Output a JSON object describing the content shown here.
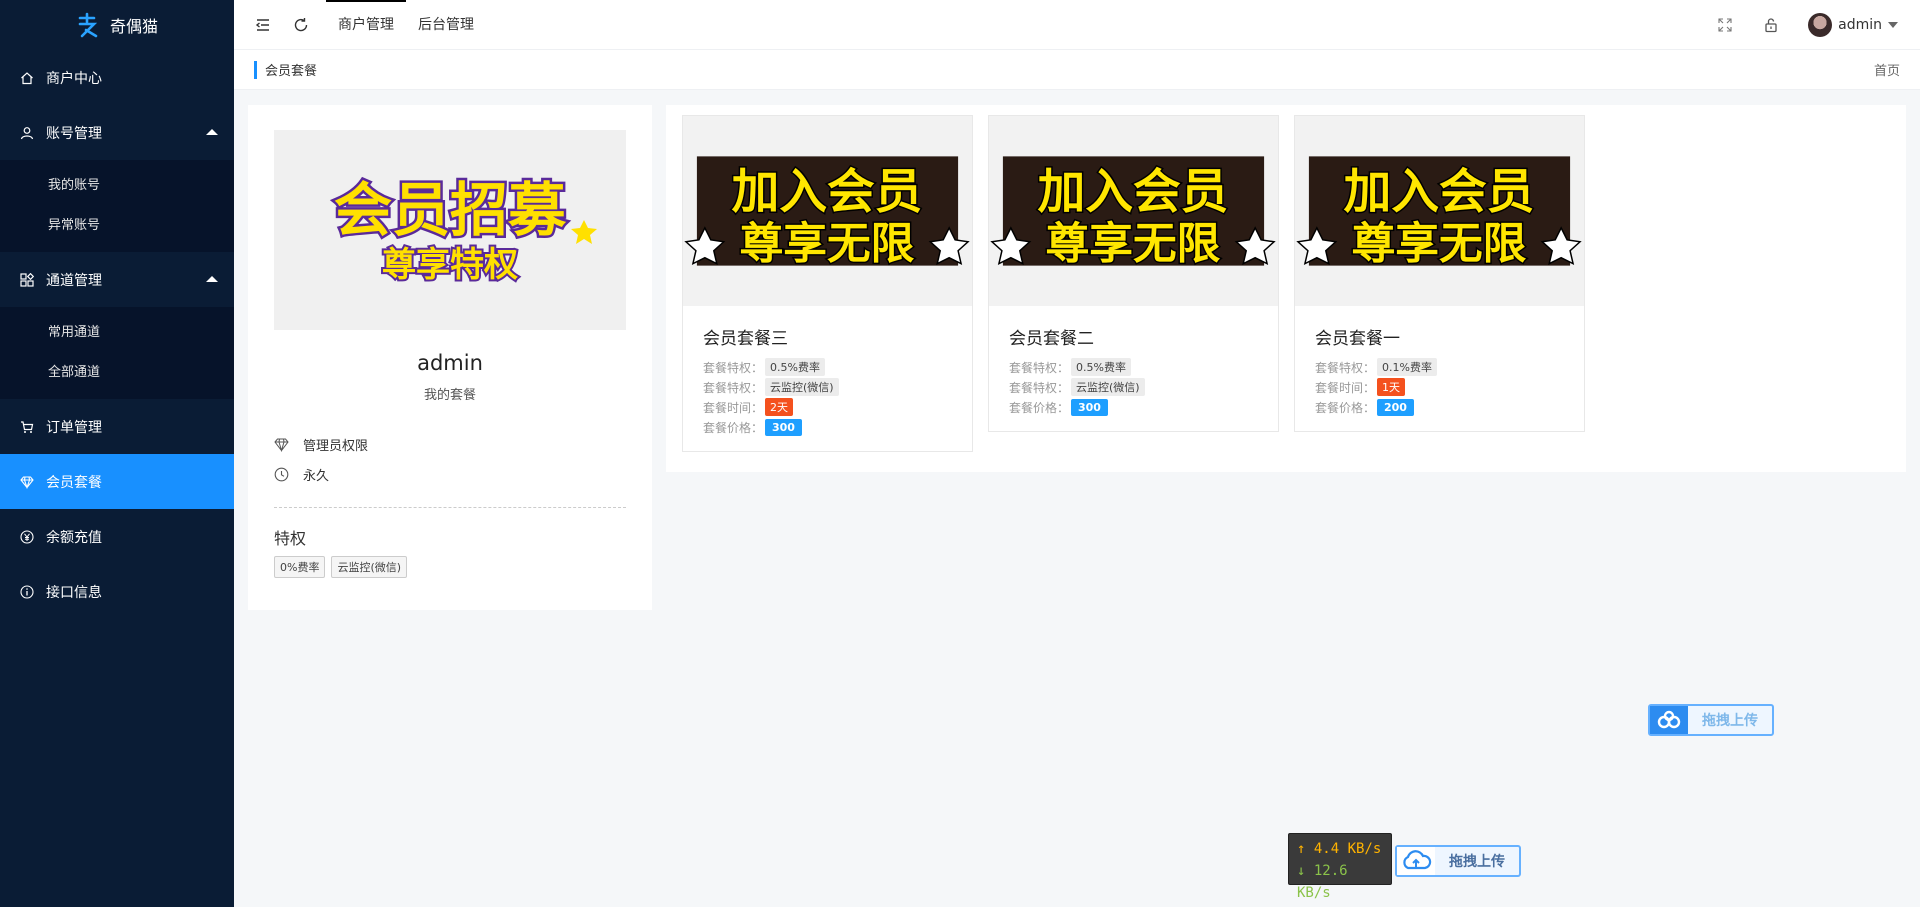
{
  "app": {
    "logo_text": "奇偶猫"
  },
  "sidebar": {
    "items": [
      {
        "label": "商户中心",
        "icon": "home-icon"
      },
      {
        "label": "账号管理",
        "icon": "user-icon",
        "children": [
          "我的账号",
          "异常账号"
        ]
      },
      {
        "label": "通道管理",
        "icon": "apps-icon",
        "children": [
          "常用通道",
          "全部通道"
        ]
      },
      {
        "label": "订单管理",
        "icon": "cart-icon"
      },
      {
        "label": "会员套餐",
        "icon": "diamond-icon",
        "active": true
      },
      {
        "label": "余额充值",
        "icon": "yen-icon"
      },
      {
        "label": "接口信息",
        "icon": "info-icon"
      }
    ]
  },
  "header": {
    "tabs": [
      {
        "label": "商户管理",
        "active": true
      },
      {
        "label": "后台管理",
        "active": false
      }
    ],
    "user_name": "admin"
  },
  "breadcrumb": {
    "current": "会员套餐",
    "home": "首页"
  },
  "profile": {
    "banner_line1": "会员招募",
    "banner_line2": "尊享特权",
    "name": "admin",
    "subtitle": "我的套餐",
    "role": "管理员权限",
    "duration": "永久",
    "privileges_title": "特权",
    "privileges": [
      "0%费率",
      "云监控(微信)"
    ]
  },
  "package_banner": {
    "line1": "加入会员",
    "line2": "尊享无限"
  },
  "labels": {
    "feature": "套餐特权：",
    "time": "套餐时间：",
    "price": "套餐价格："
  },
  "packages": [
    {
      "name": "会员套餐三",
      "features": [
        "0.5%费率",
        "云监控(微信)"
      ],
      "time": "2天",
      "price": "300"
    },
    {
      "name": "会员套餐二",
      "features": [
        "0.5%费率",
        "云监控(微信)"
      ],
      "time": "",
      "price": "300"
    },
    {
      "name": "会员套餐一",
      "features": [
        "0.1%费率"
      ],
      "time": "1天",
      "price": "200"
    }
  ],
  "widgets": {
    "upload_label": "拖拽上传",
    "upload_speed": "↑ 4.4 KB/s",
    "download_speed": "↓ 12.6 KB/s"
  },
  "colors": {
    "sidebar_bg": "#0a1c35",
    "accent": "#1890ff",
    "time_chip": "#f4511e",
    "price_chip": "#1e9fff"
  }
}
